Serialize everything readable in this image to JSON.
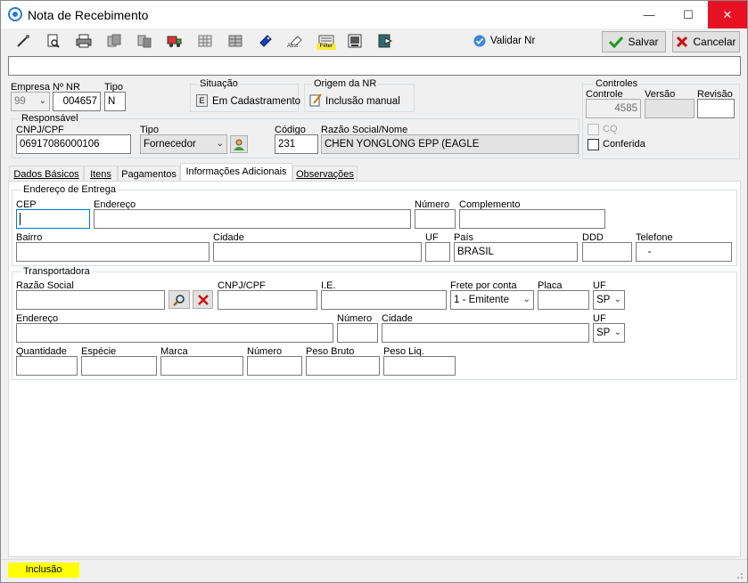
{
  "window": {
    "title": "Nota de Recebimento",
    "minimize": "—",
    "maximize": "☐",
    "close": "✕"
  },
  "toolbar": {
    "icons": [
      "wand-icon",
      "preview-icon",
      "print-icon",
      "copy-icon",
      "copy-alt-icon",
      "truck-icon",
      "grid-icon",
      "grid-alt-icon",
      "tag-icon",
      "auto-icon",
      "filter-icon",
      "image-icon",
      "export-icon"
    ],
    "auto_label": "Auto",
    "filter_label": "Filter",
    "validate_label": "Validar Nr",
    "save_label": "Salvar",
    "cancel_label": "Cancelar"
  },
  "header": {
    "empresa_label": "Empresa",
    "empresa_value": "99",
    "nr_label": "Nº NR",
    "nr_value": "004657",
    "tipo_label": "Tipo",
    "tipo_value": "N",
    "situacao_title": "Situação",
    "situacao_badge": "E",
    "situacao_value": "Em Cadastramento",
    "origem_title": "Origem da NR",
    "origem_value": "Inclusão manual",
    "controles_title": "Controles",
    "controle_label": "Controle",
    "controle_value": "4585",
    "versao_label": "Versão",
    "versao_value": "",
    "revisao_label": "Revisão",
    "revisao_value": "",
    "cq_label": "CQ",
    "conferida_label": "Conferida"
  },
  "responsavel": {
    "title": "Responsável",
    "cnpj_label": "CNPJ/CPF",
    "cnpj_value": "06917086000106",
    "tipo_label": "Tipo",
    "tipo_value": "Fornecedor",
    "codigo_label": "Código",
    "codigo_value": "231",
    "razao_label": "Razão Social/Nome",
    "razao_value": "CHEN YONGLONG  EPP (EAGLE"
  },
  "tabs": [
    {
      "label": "Dados Básicos"
    },
    {
      "label": "Itens"
    },
    {
      "label": "Pagamentos"
    },
    {
      "label": "Informações Adicionais"
    },
    {
      "label": "Observações"
    }
  ],
  "endereco_entrega": {
    "title": "Endereço de Entrega",
    "cep_label": "CEP",
    "cep_value": "",
    "endereco_label": "Endereço",
    "endereco_value": "",
    "numero_label": "Número",
    "numero_value": "",
    "complemento_label": "Complemento",
    "complemento_value": "",
    "bairro_label": "Bairro",
    "bairro_value": "",
    "cidade_label": "Cidade",
    "cidade_value": "",
    "uf_label": "UF",
    "uf_value": "",
    "pais_label": "País",
    "pais_value": "BRASIL",
    "ddd_label": "DDD",
    "ddd_value": "",
    "telefone_label": "Telefone",
    "telefone_value": "   -"
  },
  "transportadora": {
    "title": "Transportadora",
    "razao_label": "Razão Social",
    "razao_value": "",
    "cnpj_label": "CNPJ/CPF",
    "cnpj_value": "",
    "ie_label": "I.E.",
    "ie_value": "",
    "frete_label": "Frete por conta",
    "frete_value": "1 - Emitente",
    "placa_label": "Placa",
    "placa_value": "",
    "uf_label": "UF",
    "uf_value": "SP",
    "endereco_label": "Endereço",
    "endereco_value": "",
    "numero_label": "Número",
    "numero_value": "",
    "cidade_label": "Cidade",
    "cidade_value": "",
    "uf2_label": "UF",
    "uf2_value": "SP",
    "quantidade_label": "Quantidade",
    "especie_label": "Espécie",
    "marca_label": "Marca",
    "numero2_label": "Número",
    "peso_bruto_label": "Peso Bruto",
    "peso_liq_label": "Peso Liq."
  },
  "status": {
    "mode": "Inclusão"
  }
}
